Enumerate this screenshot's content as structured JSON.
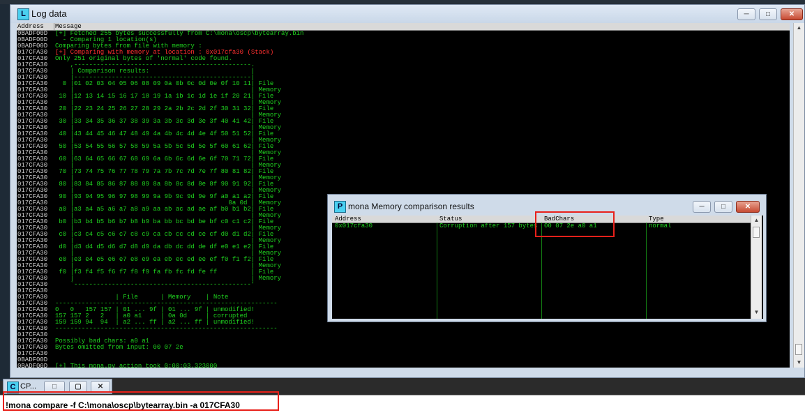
{
  "log_window": {
    "title": "Log data",
    "icon_letter": "L",
    "columns": {
      "address": "Address",
      "message": "Message"
    },
    "rows": [
      {
        "addr": "0BADF00D",
        "msg": "[+] Fetched 255 bytes successfully from C:\\mona\\oscp\\bytearray.bin",
        "red": false
      },
      {
        "addr": "0BADF00D",
        "msg": "  - Comparing 1 location(s)",
        "red": false
      },
      {
        "addr": "0BADF00D",
        "msg": "Comparing bytes from file with memory :",
        "red": false
      },
      {
        "addr": "017CFA30",
        "msg": "[+] Comparing with memory at location : 0x017cfa30 (Stack)",
        "red": true
      },
      {
        "addr": "017CFA30",
        "msg": "Only 251 original bytes of 'normal' code found.",
        "red": false
      },
      {
        "addr": "017CFA30",
        "msg": "    ,-----------------------------------------------.",
        "red": false
      },
      {
        "addr": "017CFA30",
        "msg": "    | Comparison results:                           |",
        "red": false
      },
      {
        "addr": "017CFA30",
        "msg": "    |-----------------------------------------------|",
        "red": false
      },
      {
        "addr": "017CFA30",
        "msg": "  0 |01 02 03 04 05 06 08 09 0a 0b 0c 0d 0e 0f 10 11| File",
        "red": false
      },
      {
        "addr": "017CFA30",
        "msg": "    |                                               | Memory",
        "red": false
      },
      {
        "addr": "017CFA30",
        "msg": " 10 |12 13 14 15 16 17 18 19 1a 1b 1c 1d 1e 1f 20 21| File",
        "red": false
      },
      {
        "addr": "017CFA30",
        "msg": "    |                                               | Memory",
        "red": false
      },
      {
        "addr": "017CFA30",
        "msg": " 20 |22 23 24 25 26 27 28 29 2a 2b 2c 2d 2f 30 31 32| File",
        "red": false
      },
      {
        "addr": "017CFA30",
        "msg": "    |                                               | Memory",
        "red": false
      },
      {
        "addr": "017CFA30",
        "msg": " 30 |33 34 35 36 37 38 39 3a 3b 3c 3d 3e 3f 40 41 42| File",
        "red": false
      },
      {
        "addr": "017CFA30",
        "msg": "    |                                               | Memory",
        "red": false
      },
      {
        "addr": "017CFA30",
        "msg": " 40 |43 44 45 46 47 48 49 4a 4b 4c 4d 4e 4f 50 51 52| File",
        "red": false
      },
      {
        "addr": "017CFA30",
        "msg": "    |                                               | Memory",
        "red": false
      },
      {
        "addr": "017CFA30",
        "msg": " 50 |53 54 55 56 57 58 59 5a 5b 5c 5d 5e 5f 60 61 62| File",
        "red": false
      },
      {
        "addr": "017CFA30",
        "msg": "    |                                               | Memory",
        "red": false
      },
      {
        "addr": "017CFA30",
        "msg": " 60 |63 64 65 66 67 68 69 6a 6b 6c 6d 6e 6f 70 71 72| File",
        "red": false
      },
      {
        "addr": "017CFA30",
        "msg": "    |                                               | Memory",
        "red": false
      },
      {
        "addr": "017CFA30",
        "msg": " 70 |73 74 75 76 77 78 79 7a 7b 7c 7d 7e 7f 80 81 82| File",
        "red": false
      },
      {
        "addr": "017CFA30",
        "msg": "    |                                               | Memory",
        "red": false
      },
      {
        "addr": "017CFA30",
        "msg": " 80 |83 84 85 86 87 88 89 8a 8b 8c 8d 8e 8f 90 91 92| File",
        "red": false
      },
      {
        "addr": "017CFA30",
        "msg": "    |                                               | Memory",
        "red": false
      },
      {
        "addr": "017CFA30",
        "msg": " 90 |93 94 95 96 97 98 99 9a 9b 9c 9d 9e 9f a0 a1 a2| File",
        "red": false
      },
      {
        "addr": "017CFA30",
        "msg": "    |                                         0a 0d | Memory",
        "red": false
      },
      {
        "addr": "017CFA30",
        "msg": " a0 |a3 a4 a5 a6 a7 a8 a9 aa ab ac ad ae af b0 b1 b2| File",
        "red": false
      },
      {
        "addr": "017CFA30",
        "msg": "    |                                               | Memory",
        "red": false
      },
      {
        "addr": "017CFA30",
        "msg": " b0 |b3 b4 b5 b6 b7 b8 b9 ba bb bc bd be bf c0 c1 c2| File",
        "red": false
      },
      {
        "addr": "017CFA30",
        "msg": "    |                                               | Memory",
        "red": false
      },
      {
        "addr": "017CFA30",
        "msg": " c0 |c3 c4 c5 c6 c7 c8 c9 ca cb cc cd ce cf d0 d1 d2| File",
        "red": false
      },
      {
        "addr": "017CFA30",
        "msg": "    |                                               | Memory",
        "red": false
      },
      {
        "addr": "017CFA30",
        "msg": " d0 |d3 d4 d5 d6 d7 d8 d9 da db dc dd de df e0 e1 e2| File",
        "red": false
      },
      {
        "addr": "017CFA30",
        "msg": "    |                                               | Memory",
        "red": false
      },
      {
        "addr": "017CFA30",
        "msg": " e0 |e3 e4 e5 e6 e7 e8 e9 ea eb ec ed ee ef f0 f1 f2| File",
        "red": false
      },
      {
        "addr": "017CFA30",
        "msg": "    |                                               | Memory",
        "red": false
      },
      {
        "addr": "017CFA30",
        "msg": " f0 |f3 f4 f5 f6 f7 f8 f9 fa fb fc fd fe ff         | File",
        "red": false
      },
      {
        "addr": "017CFA30",
        "msg": "    |                                               | Memory",
        "red": false
      },
      {
        "addr": "017CFA30",
        "msg": "    `-----------------------------------------------'",
        "red": false
      },
      {
        "addr": "017CFA30",
        "msg": "",
        "red": false
      },
      {
        "addr": "017CFA30",
        "msg": "                | File      | Memory    | Note",
        "red": false
      },
      {
        "addr": "017CFA30",
        "msg": "-----------------------------------------------------------",
        "red": false
      },
      {
        "addr": "017CFA30",
        "msg": "0   0   157 157 | 01 ... 9f | 01 ... 9f | unmodified!",
        "red": false
      },
      {
        "addr": "017CFA30",
        "msg": "157 157 2   2   | a0 a1     | 0a 0d     | corrupted",
        "red": false
      },
      {
        "addr": "017CFA30",
        "msg": "159 159 94  94  | a2 ... ff | a2 ... ff | unmodified!",
        "red": false
      },
      {
        "addr": "017CFA30",
        "msg": "-----------------------------------------------------------",
        "red": false
      },
      {
        "addr": "017CFA30",
        "msg": "",
        "red": false
      },
      {
        "addr": "017CFA30",
        "msg": "Possibly bad chars: a0 a1",
        "red": false
      },
      {
        "addr": "017CFA30",
        "msg": "Bytes omitted from input: 00 07 2e",
        "red": false
      },
      {
        "addr": "017CFA30",
        "msg": "",
        "red": false
      },
      {
        "addr": "0BADF00D",
        "msg": "",
        "red": false
      },
      {
        "addr": "0BADF00D",
        "msg": "[+] This mona.py action took 0:00:03.323000",
        "red": false
      }
    ]
  },
  "mona_window": {
    "title": "mona Memory comparison results",
    "icon_letter": "P",
    "columns": [
      "Address",
      "Status",
      "BadChars",
      "Type"
    ],
    "row": {
      "address": "0x017cfa30",
      "status": "Corruption after 157 bytes",
      "badchars": "00 07 2e a0 a1",
      "type": "normal"
    }
  },
  "cpu_tab": {
    "icon_letter": "C",
    "label": "CP..."
  },
  "command_bar": {
    "value": "!mona compare -f C:\\mona\\oscp\\bytearray.bin -a 017CFA30"
  },
  "colors": {
    "log_text": "#1fd11f",
    "error_text": "#ff3030",
    "highlight_box": "#e8201a",
    "background": "#000000"
  },
  "icons": [
    "minimize-icon",
    "restore-icon",
    "close-icon",
    "scroll-up-icon",
    "scroll-down-icon"
  ]
}
